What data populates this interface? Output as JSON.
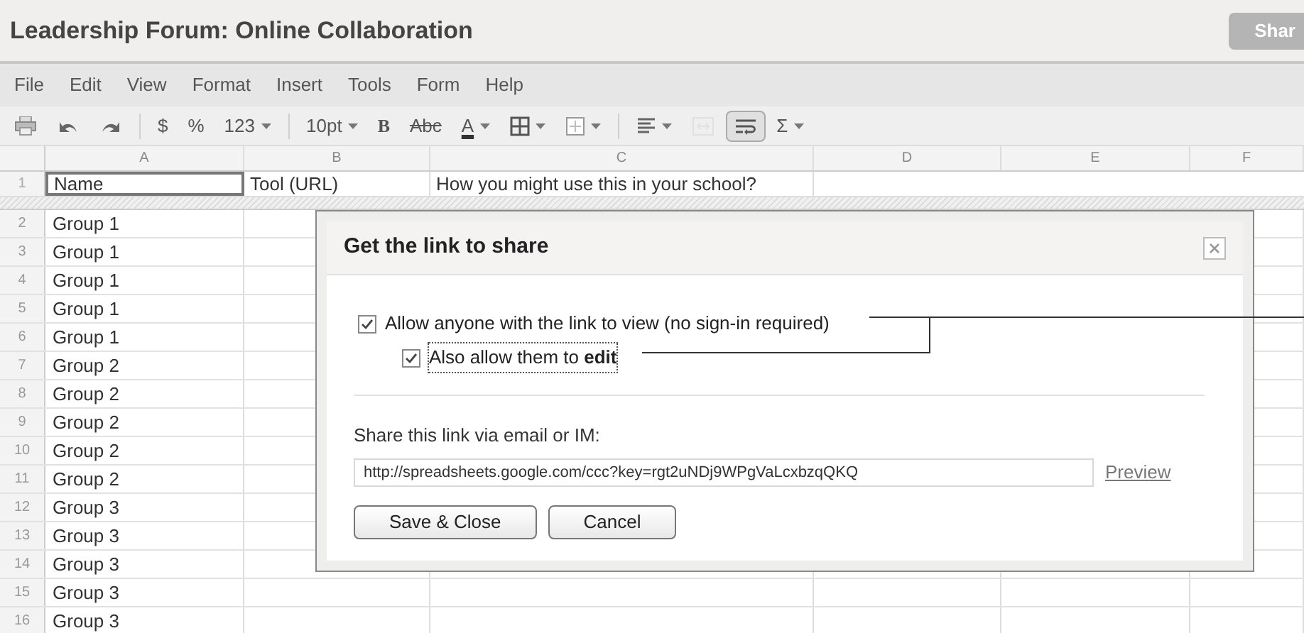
{
  "document_title": "Leadership Forum: Online Collaboration",
  "share_button": "Shar",
  "menu": [
    "File",
    "Edit",
    "View",
    "Format",
    "Insert",
    "Tools",
    "Form",
    "Help"
  ],
  "toolbar": [
    {
      "kind": "icon",
      "dropdown": false,
      "selected": false,
      "disabled": false
    },
    {
      "kind": "icon",
      "dropdown": false,
      "selected": false,
      "disabled": false
    },
    {
      "kind": "icon",
      "dropdown": false,
      "selected": false,
      "disabled": false
    },
    {
      "kind": "separator"
    },
    {
      "kind": "text",
      "label": "$",
      "dropdown": false,
      "selected": false,
      "disabled": false
    },
    {
      "kind": "text",
      "label": "%",
      "dropdown": false,
      "selected": false,
      "disabled": false
    },
    {
      "kind": "text",
      "label": "123",
      "dropdown": true,
      "selected": false,
      "disabled": false
    },
    {
      "kind": "separator"
    },
    {
      "kind": "text",
      "label": "10pt",
      "dropdown": true,
      "selected": false,
      "disabled": false
    },
    {
      "kind": "text",
      "label": "B",
      "dropdown": false,
      "selected": false,
      "disabled": false
    },
    {
      "kind": "text",
      "label": "Abc",
      "dropdown": false,
      "selected": false,
      "disabled": false
    },
    {
      "kind": "text",
      "label": "A",
      "dropdown": true,
      "selected": false,
      "disabled": false
    },
    {
      "kind": "icon",
      "dropdown": true,
      "selected": false,
      "disabled": false
    },
    {
      "kind": "icon",
      "dropdown": true,
      "selected": false,
      "disabled": false
    },
    {
      "kind": "separator"
    },
    {
      "kind": "icon",
      "dropdown": true,
      "selected": false,
      "disabled": false
    },
    {
      "kind": "icon",
      "dropdown": false,
      "selected": false,
      "disabled": true
    },
    {
      "kind": "icon",
      "dropdown": false,
      "selected": true,
      "disabled": false
    },
    {
      "kind": "text",
      "label": "Σ",
      "dropdown": true,
      "selected": false,
      "disabled": false
    }
  ],
  "columns": [
    "A",
    "B",
    "C",
    "D",
    "E",
    "F"
  ],
  "header_row": {
    "number": "1",
    "cells": [
      {
        "text": "Name",
        "selected": true
      },
      {
        "text": "Tool (URL)",
        "selected": false
      },
      {
        "text": "How you might use this in your school?",
        "selected": false
      }
    ]
  },
  "rows": [
    {
      "number": "2",
      "cell": "Group 1"
    },
    {
      "number": "3",
      "cell": "Group 1"
    },
    {
      "number": "4",
      "cell": "Group 1"
    },
    {
      "number": "5",
      "cell": "Group 1"
    },
    {
      "number": "6",
      "cell": "Group 1"
    },
    {
      "number": "7",
      "cell": "Group 2"
    },
    {
      "number": "8",
      "cell": "Group 2"
    },
    {
      "number": "9",
      "cell": "Group 2"
    },
    {
      "number": "10",
      "cell": "Group 2"
    },
    {
      "number": "11",
      "cell": "Group 2"
    },
    {
      "number": "12",
      "cell": "Group 3"
    },
    {
      "number": "13",
      "cell": "Group 3"
    },
    {
      "number": "14",
      "cell": "Group 3"
    },
    {
      "number": "15",
      "cell": "Group 3"
    },
    {
      "number": "16",
      "cell": "Group 3"
    }
  ],
  "dialog": {
    "title": "Get the link to share",
    "options": [
      {
        "label": "Allow anyone with the link to view (no sign-in required)",
        "checked": true,
        "nested": false
      },
      {
        "label": "Also allow them to **edit**",
        "checked": true,
        "nested": true
      }
    ],
    "share_label": "Share this link via email or IM:",
    "link": "http://spreadsheets.google.com/ccc?key=rgt2uNDj9WPgVaLcxbzqQKQ",
    "preview_link": "Preview",
    "buttons": [
      "Save & Close",
      "Cancel"
    ]
  }
}
